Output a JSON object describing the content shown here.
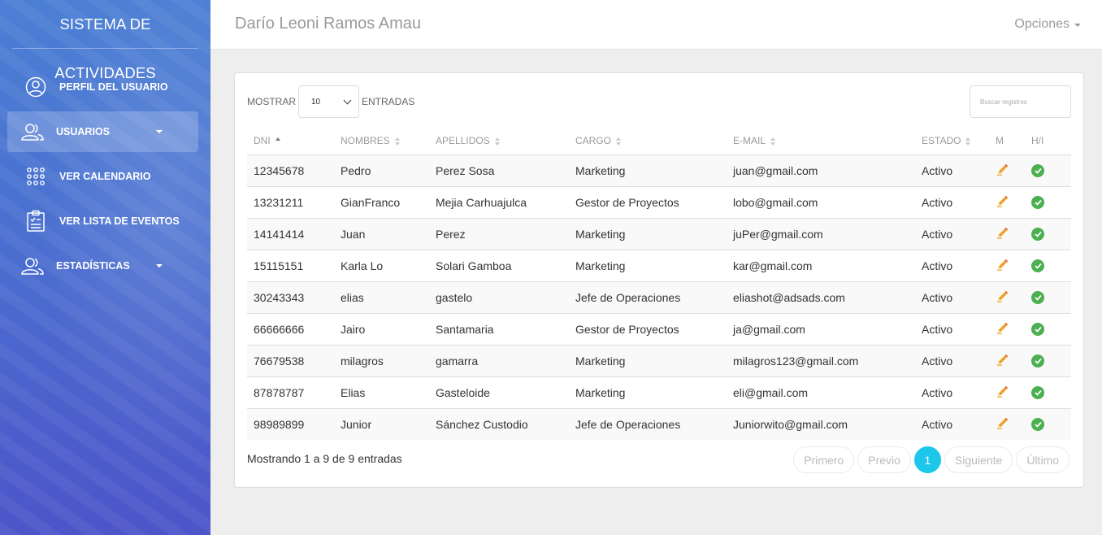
{
  "sidebar": {
    "brand": "SISTEMA DE ACTIVIDADES",
    "items": [
      {
        "label": "PERFIL DEL USUARIO",
        "icon": "user-circle-icon"
      },
      {
        "label": "USUARIOS",
        "icon": "users-icon",
        "active": true
      },
      {
        "label": "VER CALENDARIO",
        "icon": "grid-dots-icon"
      },
      {
        "label": "VER LISTA DE EVENTOS",
        "icon": "clipboard-list-icon"
      },
      {
        "label": "ESTADÍSTICAS",
        "icon": "users-icon"
      }
    ]
  },
  "header": {
    "user_name": "Darío Leoni Ramos Amau",
    "options_label": "Opciones"
  },
  "table_controls": {
    "show_label": "MOSTRAR",
    "entries_label": "ENTRADAS",
    "page_size": "10",
    "search_placeholder": "Buscar registros"
  },
  "table": {
    "columns": [
      "DNI",
      "NOMBRES",
      "APELLIDOS",
      "CARGO",
      "E-MAIL",
      "ESTADO",
      "M",
      "H/I"
    ],
    "rows": [
      {
        "dni": "12345678",
        "nombres": "Pedro",
        "apellidos": "Perez Sosa",
        "cargo": "Marketing",
        "email": "juan@gmail.com",
        "estado": "Activo"
      },
      {
        "dni": "13231211",
        "nombres": "GianFranco",
        "apellidos": "Mejia Carhuajulca",
        "cargo": "Gestor de Proyectos",
        "email": "lobo@gmail.com",
        "estado": "Activo"
      },
      {
        "dni": "14141414",
        "nombres": "Juan",
        "apellidos": "Perez",
        "cargo": "Marketing",
        "email": "juPer@gmail.com",
        "estado": "Activo"
      },
      {
        "dni": "15115151",
        "nombres": "Karla Lo",
        "apellidos": "Solari Gamboa",
        "cargo": "Marketing",
        "email": "kar@gmail.com",
        "estado": "Activo"
      },
      {
        "dni": "30243343",
        "nombres": "elias",
        "apellidos": "gastelo",
        "cargo": "Jefe de Operaciones",
        "email": "eliashot@adsads.com",
        "estado": "Activo"
      },
      {
        "dni": "66666666",
        "nombres": "Jairo",
        "apellidos": "Santamaria",
        "cargo": "Gestor de Proyectos",
        "email": "ja@gmail.com",
        "estado": "Activo"
      },
      {
        "dni": "76679538",
        "nombres": "milagros",
        "apellidos": "gamarra",
        "cargo": "Marketing",
        "email": "milagros123@gmail.com",
        "estado": "Activo"
      },
      {
        "dni": "87878787",
        "nombres": "Elias",
        "apellidos": "Gasteloide",
        "cargo": "Marketing",
        "email": "eli@gmail.com",
        "estado": "Activo"
      },
      {
        "dni": "98989899",
        "nombres": "Junior",
        "apellidos": "Sánchez Custodio",
        "cargo": "Jefe de Operaciones",
        "email": "Juniorwito@gmail.com",
        "estado": "Activo"
      }
    ]
  },
  "footer": {
    "info": "Mostrando 1 a 9 de 9 entradas",
    "first": "Primero",
    "prev": "Previo",
    "current_page": "1",
    "next": "Siguiente",
    "last": "Último"
  },
  "colors": {
    "accent": "#1dc7ea",
    "edit_icon": "#f0a020",
    "status_check": "#4caf50"
  }
}
